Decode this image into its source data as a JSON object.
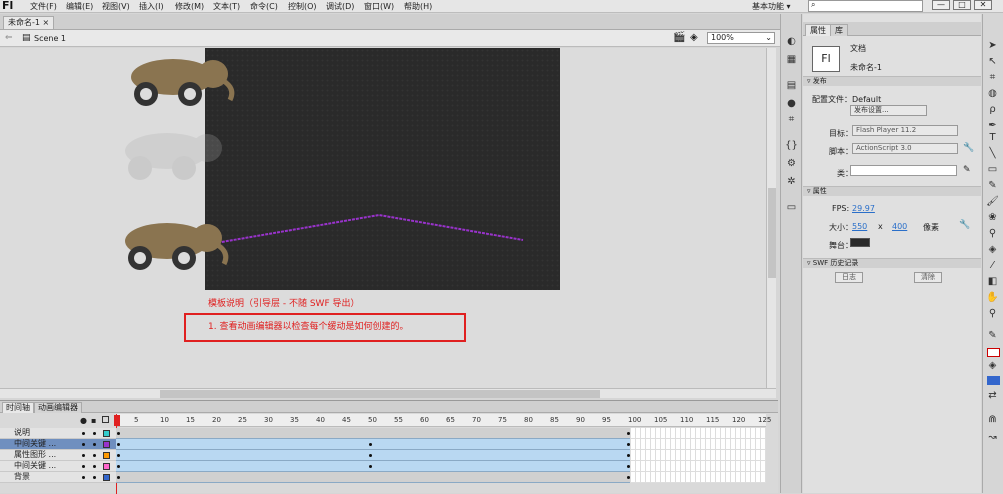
{
  "app": {
    "logo": "Fl",
    "workspace": "基本功能",
    "workspace_arrow": "▾"
  },
  "menu": [
    "文件(F)",
    "编辑(E)",
    "视图(V)",
    "插入(I)",
    "修改(M)",
    "文本(T)",
    "命令(C)",
    "控制(O)",
    "调试(D)",
    "窗口(W)",
    "帮助(H)"
  ],
  "window_controls": [
    "—",
    "□",
    "✕"
  ],
  "doc_tab": {
    "label": "未命名-1 ×"
  },
  "scene": {
    "label": "Scene 1",
    "zoom": "100%"
  },
  "stage": {
    "guide_title": "模板说明（引导层 - 不随 SWF 导出）",
    "note": "1. 查看动画编辑器以检查每个缓动是如何创建的。"
  },
  "timeline": {
    "tabs": [
      "时间轴",
      "动画编辑器"
    ],
    "ticks": [
      "1",
      "5",
      "10",
      "15",
      "20",
      "25",
      "30",
      "35",
      "40",
      "45",
      "50",
      "55",
      "60",
      "65",
      "70",
      "75",
      "80",
      "85",
      "90",
      "95",
      "100",
      "105",
      "110",
      "115",
      "120",
      "125"
    ],
    "layers": [
      {
        "name": "说明",
        "color": "#33cccc"
      },
      {
        "name": "中间关键 ...",
        "color": "#9933cc"
      },
      {
        "name": "属性图形 ...",
        "color": "#ff9900"
      },
      {
        "name": "中间关键 ...",
        "color": "#ff66cc"
      },
      {
        "name": "背景",
        "color": "#3366cc"
      }
    ]
  },
  "properties": {
    "tabs": [
      "属性",
      "库"
    ],
    "doc_icon": "Fl",
    "doc_type": "文档",
    "doc_name": "未命名-1",
    "publish_section": "发布",
    "profile_label": "配置文件：Default",
    "publish_settings_btn": "发布设置...",
    "target_label": "目标：",
    "target_value": "Flash Player 11.2",
    "script_label": "脚本：",
    "script_value": "ActionScript 3.0",
    "class_label": "类：",
    "props_section": "属性",
    "fps_label": "FPS:",
    "fps_value": "29.97",
    "size_label": "大小：",
    "width": "550",
    "x_sep": "x",
    "height": "400",
    "unit": "像素",
    "stage_label": "舞台：",
    "stage_color": "#2a2a2a",
    "history_section": "SWF 历史记录",
    "log_btn": "日志",
    "clear_btn": "清除"
  }
}
